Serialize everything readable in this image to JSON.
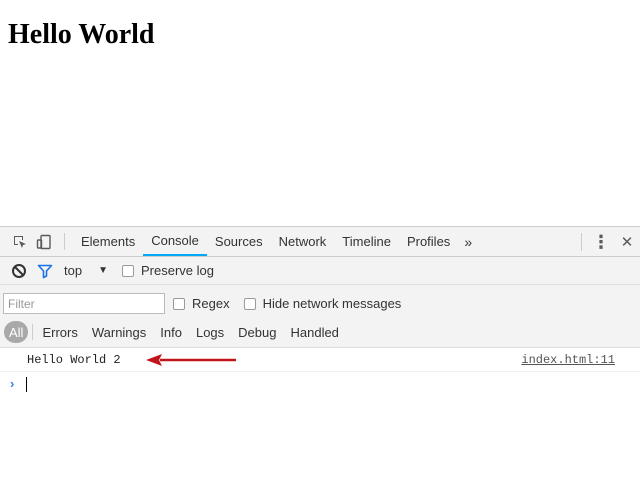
{
  "page": {
    "heading": "Hello World"
  },
  "devtools": {
    "tabs": [
      {
        "label": "Elements",
        "active": false
      },
      {
        "label": "Console",
        "active": true
      },
      {
        "label": "Sources",
        "active": false
      },
      {
        "label": "Network",
        "active": false
      },
      {
        "label": "Timeline",
        "active": false
      },
      {
        "label": "Profiles",
        "active": false
      }
    ],
    "more_tabs_glyph": "»",
    "menu_glyph": "⋮",
    "close_glyph": "✕",
    "icons": {
      "inspect": "inspect-element-icon",
      "device": "device-toggle-icon",
      "clear": "clear-console-icon",
      "filter": "filter-icon"
    },
    "accent_color": "#03a9f4"
  },
  "console_toolbar": {
    "context_value": "top",
    "preserve_log_label": "Preserve log"
  },
  "filter_bar": {
    "filter_placeholder": "Filter",
    "filter_value": "",
    "regex_label": "Regex",
    "hide_network_label": "Hide network messages",
    "levels": [
      {
        "label": "All",
        "active": true
      },
      {
        "label": "Errors",
        "active": false
      },
      {
        "label": "Warnings",
        "active": false
      },
      {
        "label": "Info",
        "active": false
      },
      {
        "label": "Logs",
        "active": false
      },
      {
        "label": "Debug",
        "active": false
      },
      {
        "label": "Handled",
        "active": false
      }
    ]
  },
  "console_messages": [
    {
      "text": "Hello World 2",
      "source": "index.html:11"
    }
  ],
  "prompt": {
    "chevron": "›",
    "value": ""
  },
  "annotation_color": "#c0151b"
}
